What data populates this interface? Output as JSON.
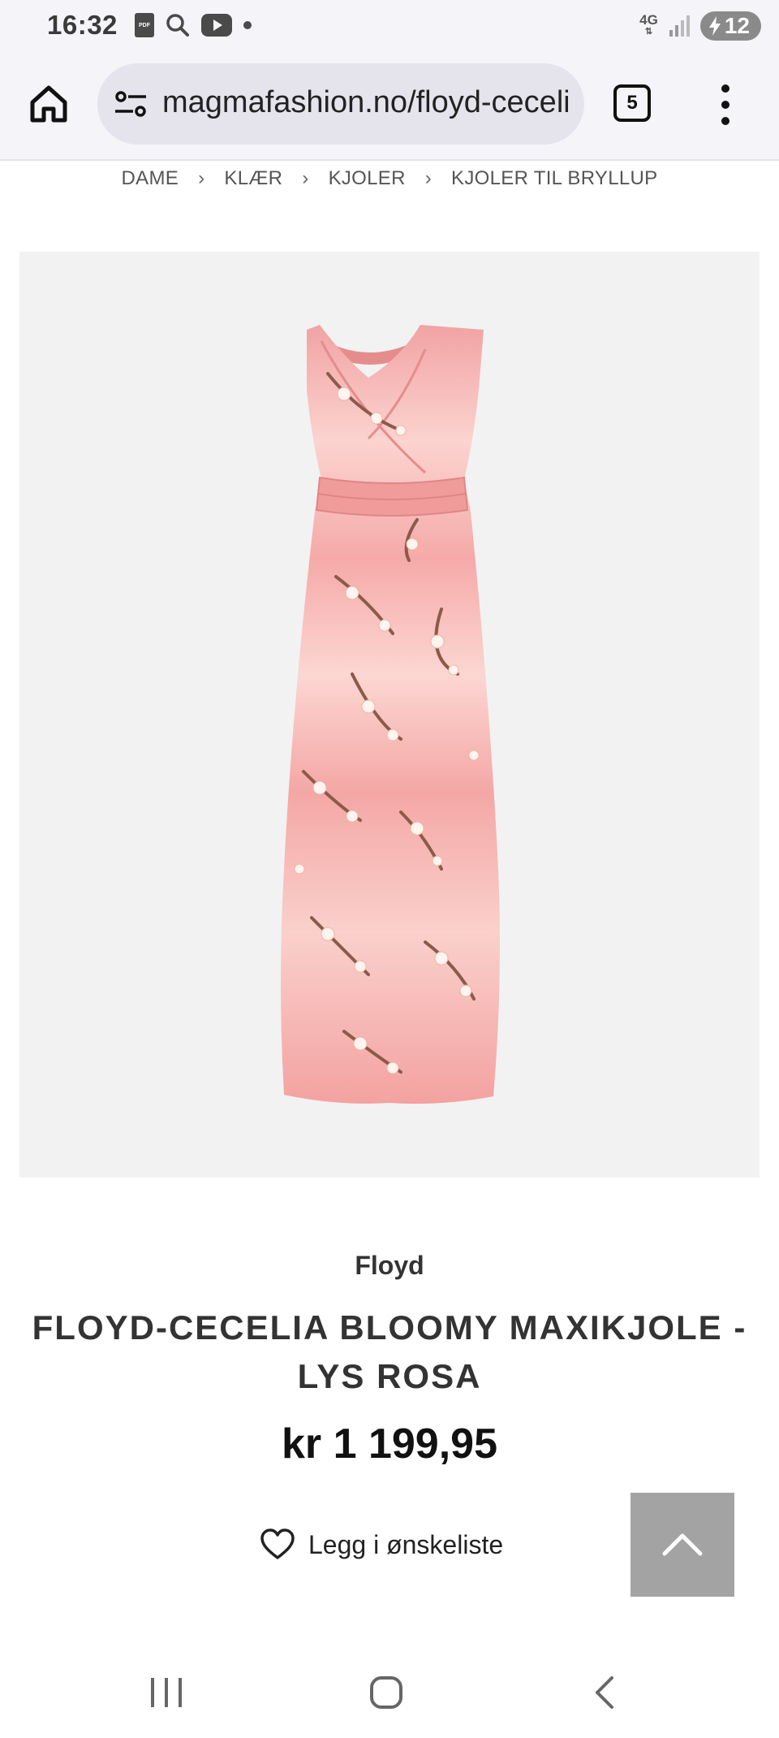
{
  "status_bar": {
    "time": "16:32",
    "icons": [
      "pdf-icon",
      "search-icon",
      "youtube-icon",
      "dot-icon"
    ],
    "network": "4G",
    "battery": "12"
  },
  "browser": {
    "url": "magmafashion.no/floyd-cecelia",
    "tab_count": "5"
  },
  "breadcrumb": [
    "DAME",
    "KLÆR",
    "KJOLER",
    "KJOLER TIL BRYLLUP"
  ],
  "product": {
    "brand": "Floyd",
    "title": "FLOYD-CECELIA BLOOMY MAXIKJOLE - LYS ROSA",
    "price": "kr 1 199,95",
    "wishlist_label": "Legg i ønskeliste"
  },
  "colors": {
    "dress_pink": "#f4a9a8",
    "dress_light": "#fbd7d2",
    "branch": "#8c5a4a",
    "image_bg": "#f2f2f2",
    "scroll_top_bg": "#a3a3a3"
  }
}
